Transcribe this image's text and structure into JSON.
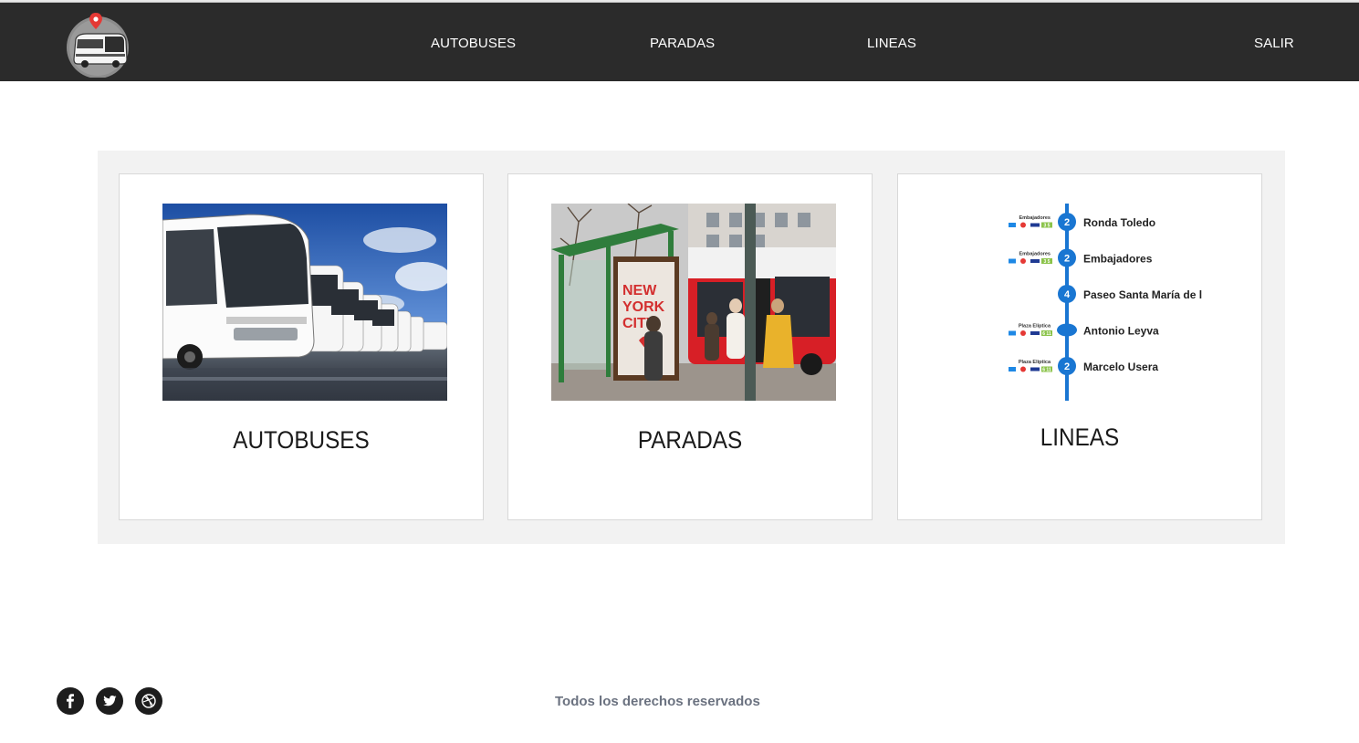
{
  "nav": {
    "links": [
      {
        "label": "AUTOBUSES"
      },
      {
        "label": "PARADAS"
      },
      {
        "label": "LINEAS"
      }
    ],
    "logout_label": "SALIR"
  },
  "cards": [
    {
      "title": "AUTOBUSES",
      "image": "buses-parked-photo"
    },
    {
      "title": "PARADAS",
      "image": "bus-stop-photo"
    },
    {
      "title": "LINEAS",
      "image": "line-map-diagram"
    }
  ],
  "line_map": {
    "stops": [
      {
        "number": "2",
        "name": "Ronda Toledo",
        "connection": "Embajadores",
        "connection_lines": "3 5"
      },
      {
        "number": "2",
        "name": "Embajadores",
        "connection": "Embajadores",
        "connection_lines": "3 5"
      },
      {
        "number": "4",
        "name": "Paseo Santa María de l",
        "connection": "",
        "connection_lines": ""
      },
      {
        "number": "",
        "name": "Antonio Leyva",
        "connection": "Plaza Elíptica",
        "connection_lines": "6 11"
      },
      {
        "number": "2",
        "name": "Marcelo Usera",
        "connection": "Plaza Elíptica",
        "connection_lines": "6 11"
      }
    ],
    "line_color": "#1976d2"
  },
  "footer": {
    "copyright": "Todos los derechos reservados",
    "social": [
      "facebook-icon",
      "twitter-icon",
      "dribbble-icon"
    ]
  },
  "colors": {
    "navbar": "#2b2b2b",
    "panel": "#f2f2f2",
    "footer_text": "#6b7280"
  },
  "new_york_sign": "NEW YORK CITY"
}
